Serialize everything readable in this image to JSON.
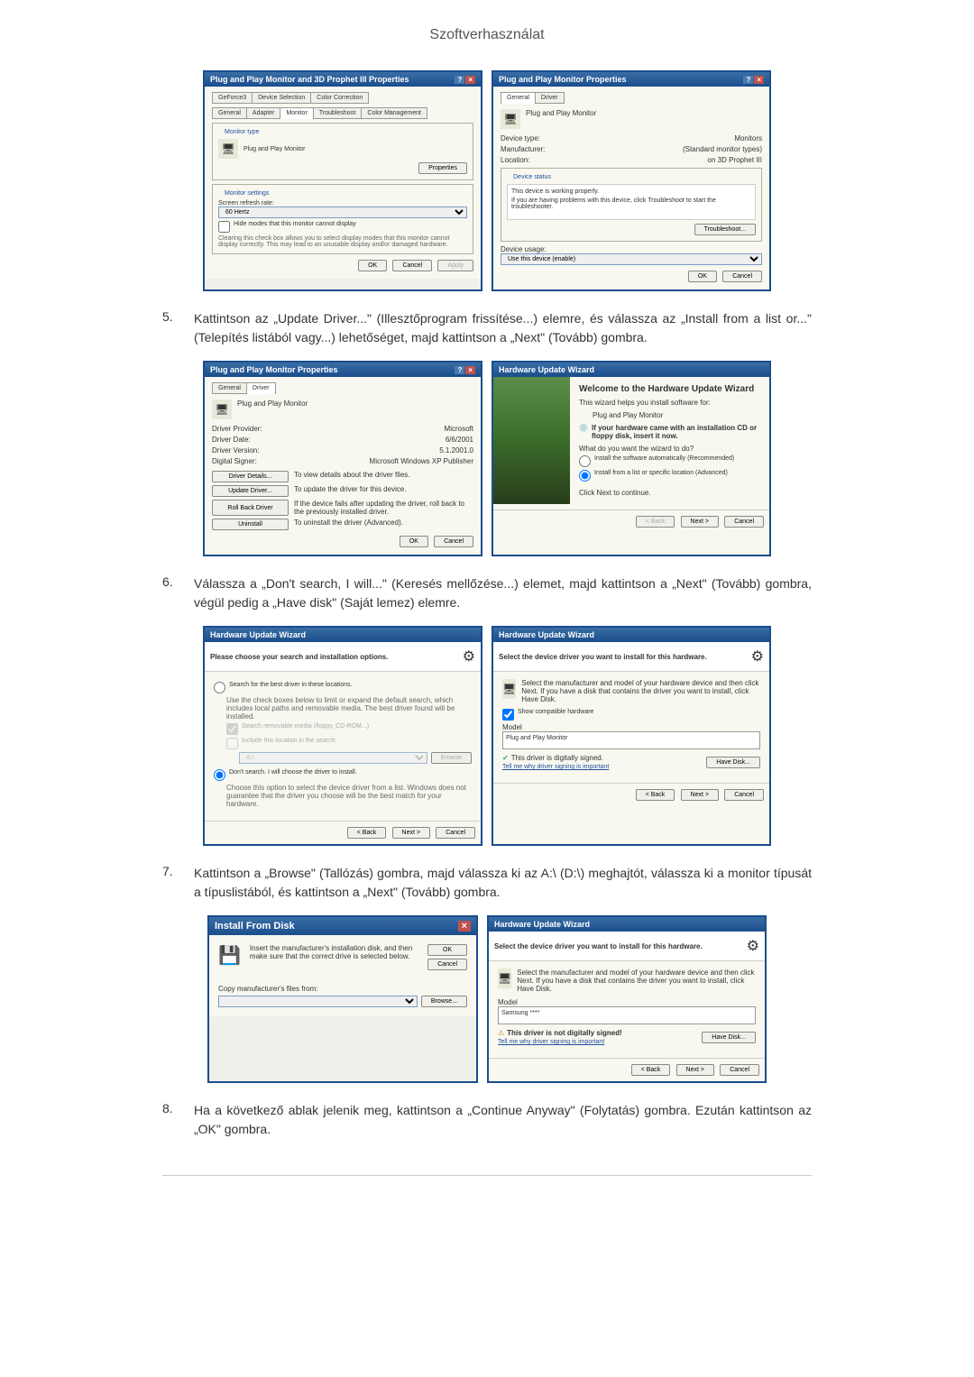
{
  "page_title": "Szoftverhasználat",
  "steps": {
    "5": {
      "num": "5.",
      "text": "Kattintson az „Update Driver...\" (Illesztőprogram frissítése...) elemre, és válassza az „Install from a list or...\" (Telepítés listából vagy...) lehetőséget, majd kattintson a „Next\" (Tovább) gombra."
    },
    "6": {
      "num": "6.",
      "text": "Válassza a „Don't search, I will...\" (Keresés mellőzése...) elemet, majd kattintson a „Next\" (Tovább) gombra, végül pedig a „Have disk\" (Saját lemez) elemre."
    },
    "7": {
      "num": "7.",
      "text": "Kattintson a „Browse\" (Tallózás) gombra, majd válassza ki az A:\\ (D:\\) meghajtót, válassza ki a monitor típusát a típuslistából, és kattintson a „Next\" (Tovább) gombra."
    },
    "8": {
      "num": "8.",
      "text": "Ha a következő ablak jelenik meg, kattintson a „Continue Anyway\" (Folytatás) gombra. Ezután kattintson az „OK\" gombra."
    }
  },
  "dlg1": {
    "title": "Plug and Play Monitor and 3D Prophet III Properties",
    "tabs": [
      "GeForce3",
      "Device Selection",
      "Color Correction",
      "General",
      "Adapter",
      "Monitor",
      "Troubleshoot",
      "Color Management"
    ],
    "monitor_type_label": "Monitor type",
    "monitor_name": "Plug and Play Monitor",
    "properties_btn": "Properties",
    "settings_label": "Monitor settings",
    "refresh_label": "Screen refresh rate:",
    "refresh_value": "60 Hertz",
    "hide_modes": "Hide modes that this monitor cannot display",
    "hide_modes_desc": "Clearing this check box allows you to select display modes that this monitor cannot display correctly. This may lead to an unusable display and/or damaged hardware.",
    "ok": "OK",
    "cancel": "Cancel",
    "apply": "Apply"
  },
  "dlg2": {
    "title": "Plug and Play Monitor Properties",
    "tabs": [
      "General",
      "Driver"
    ],
    "name": "Plug and Play Monitor",
    "device_type_lbl": "Device type:",
    "device_type": "Monitors",
    "manufacturer_lbl": "Manufacturer:",
    "manufacturer": "(Standard monitor types)",
    "location_lbl": "Location:",
    "location": "on 3D Prophet III",
    "status_group": "Device status",
    "status_text": "This device is working properly.",
    "status_help": "If you are having problems with this device, click Troubleshoot to start the troubleshooter.",
    "troubleshoot": "Troubleshoot...",
    "usage_lbl": "Device usage:",
    "usage_val": "Use this device (enable)",
    "ok": "OK",
    "cancel": "Cancel"
  },
  "dlg3": {
    "title": "Plug and Play Monitor Properties",
    "tabs": [
      "General",
      "Driver"
    ],
    "name": "Plug and Play Monitor",
    "provider_lbl": "Driver Provider:",
    "provider": "Microsoft",
    "date_lbl": "Driver Date:",
    "date": "6/6/2001",
    "version_lbl": "Driver Version:",
    "version": "5.1.2001.0",
    "signer_lbl": "Digital Signer:",
    "signer": "Microsoft Windows XP Publisher",
    "details_btn": "Driver Details...",
    "details_txt": "To view details about the driver files.",
    "update_btn": "Update Driver...",
    "update_txt": "To update the driver for this device.",
    "rollback_btn": "Roll Back Driver",
    "rollback_txt": "If the device fails after updating the driver, roll back to the previously installed driver.",
    "uninstall_btn": "Uninstall",
    "uninstall_txt": "To uninstall the driver (Advanced).",
    "ok": "OK",
    "cancel": "Cancel"
  },
  "wiz1": {
    "title": "Hardware Update Wizard",
    "heading": "Welcome to the Hardware Update Wizard",
    "intro": "This wizard helps you install software for:",
    "device": "Plug and Play Monitor",
    "cd_hint": "If your hardware came with an installation CD or floppy disk, insert it now.",
    "q": "What do you want the wizard to do?",
    "opt1": "Install the software automatically (Recommended)",
    "opt2": "Install from a list or specific location (Advanced)",
    "next_txt": "Click Next to continue.",
    "back": "< Back",
    "next": "Next >",
    "cancel": "Cancel"
  },
  "wiz2": {
    "title": "Hardware Update Wizard",
    "heading": "Please choose your search and installation options.",
    "opt1": "Search for the best driver in these locations.",
    "opt1_desc": "Use the check boxes below to limit or expand the default search, which includes local paths and removable media. The best driver found will be installed.",
    "chk1": "Search removable media (floppy, CD-ROM...)",
    "chk2": "Include this location in the search:",
    "path": "A:\\",
    "browse": "Browse",
    "opt2": "Don't search. I will choose the driver to install.",
    "opt2_desc": "Choose this option to select the device driver from a list. Windows does not guarantee that the driver you choose will be the best match for your hardware.",
    "back": "< Back",
    "next": "Next >",
    "cancel": "Cancel"
  },
  "wiz3": {
    "title": "Hardware Update Wizard",
    "heading": "Select the device driver you want to install for this hardware.",
    "desc": "Select the manufacturer and model of your hardware device and then click Next. If you have a disk that contains the driver you want to install, click Have Disk.",
    "compat": "Show compatible hardware",
    "model_lbl": "Model",
    "model": "Plug and Play Monitor",
    "signed": "This driver is digitally signed.",
    "tell": "Tell me why driver signing is important",
    "have_disk": "Have Disk...",
    "back": "< Back",
    "next": "Next >",
    "cancel": "Cancel"
  },
  "dlg4": {
    "title": "Install From Disk",
    "prompt": "Insert the manufacturer's installation disk, and then make sure that the correct drive is selected below.",
    "ok": "OK",
    "cancel": "Cancel",
    "copy_lbl": "Copy manufacturer's files from:",
    "browse": "Browse..."
  },
  "wiz4": {
    "title": "Hardware Update Wizard",
    "heading": "Select the device driver you want to install for this hardware.",
    "desc": "Select the manufacturer and model of your hardware device and then click Next. If you have a disk that contains the driver you want to install, click Have Disk.",
    "model_lbl": "Model",
    "model": "Samsung ****",
    "warn": "This driver is not digitally signed!",
    "tell": "Tell me why driver signing is important",
    "have_disk": "Have Disk...",
    "back": "< Back",
    "next": "Next >",
    "cancel": "Cancel"
  }
}
